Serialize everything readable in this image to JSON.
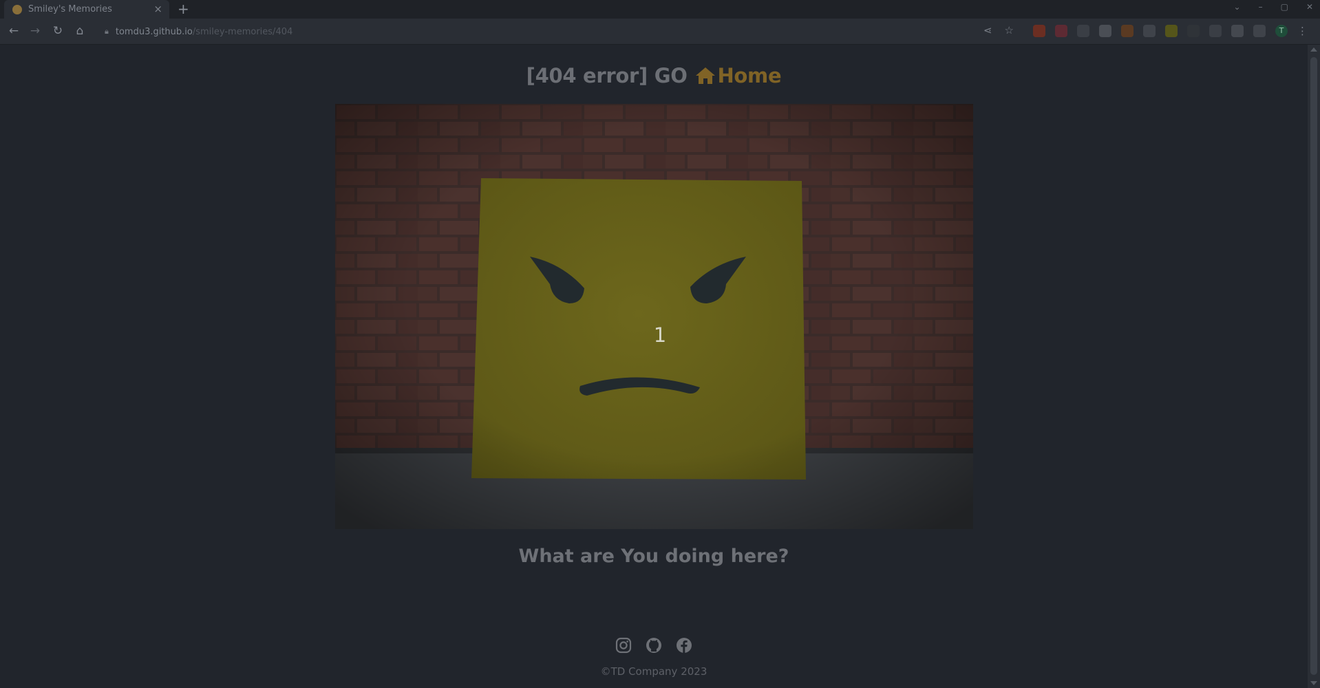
{
  "browser": {
    "tab_title": "Smiley's Memories",
    "tab_close": "×",
    "new_tab": "+",
    "url_host": "tomdu3.github.io",
    "url_path": "/smiley-memories/404",
    "profile_initial": "T"
  },
  "page": {
    "heading_prefix": "[404 error] GO",
    "home_link": "Home",
    "counter": "1",
    "tagline": "What are You doing here?",
    "copyright": "©TD Company 2023"
  },
  "colors": {
    "background": "#21252c",
    "home_accent": "#806326",
    "smiley_yellow": "#6b651a"
  },
  "icons": [
    "home-icon",
    "instagram-icon",
    "github-icon",
    "facebook-icon"
  ]
}
